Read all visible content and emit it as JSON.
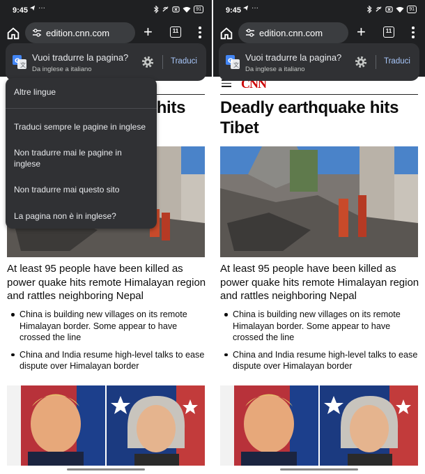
{
  "status_bar": {
    "time": "9:45",
    "battery": "91"
  },
  "toolbar": {
    "url": "edition.cnn.com",
    "tab_count": "11"
  },
  "translate_bar": {
    "title": "Vuoi tradurre la pagina?",
    "subtitle": "Da inglese a italiano",
    "action_label": "Traduci"
  },
  "translate_menu": {
    "items": [
      "Altre lingue",
      "Traduci sempre le pagine in inglese",
      "Non tradurre mai le pagine in inglese",
      "Non tradurre mai questo sito",
      "La pagina non è in inglese?"
    ]
  },
  "article": {
    "logo": "CNN",
    "headline": "Deadly earthquake hits Tibet",
    "story_title": "At least 95 people have been killed as power quake hits remote Himalayan region and rattles neighboring Nepal",
    "bullets": [
      "China is building new villages on its remote Himalayan border. Some appear to have crossed the line",
      "China and India resume high-level talks to ease dispute over Himalayan border"
    ]
  },
  "colors": {
    "chrome_dark": "#1f2022",
    "panel": "#303134",
    "accent_blue": "#a8c7fa",
    "cnn_red": "#cc0000"
  }
}
